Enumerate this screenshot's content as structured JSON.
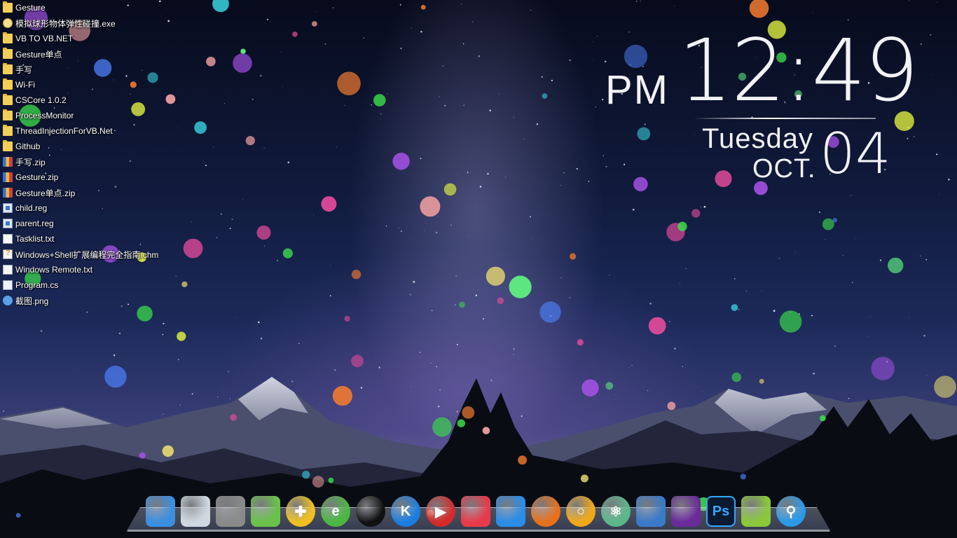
{
  "desktop_items": [
    {
      "label": "Gesture",
      "icon": "folder-icon"
    },
    {
      "label": "模拟球形物体弹性碰撞.exe",
      "icon": "exe-icon"
    },
    {
      "label": "VB TO VB.NET",
      "icon": "folder-icon"
    },
    {
      "label": "Gesture单点",
      "icon": "folder-icon"
    },
    {
      "label": "手写",
      "icon": "folder-icon"
    },
    {
      "label": "Wi-Fi",
      "icon": "folder-icon"
    },
    {
      "label": "CSCore 1.0.2",
      "icon": "folder-icon"
    },
    {
      "label": "ProcessMonitor",
      "icon": "folder-icon"
    },
    {
      "label": "ThreadInjectionForVB.Net",
      "icon": "folder-icon"
    },
    {
      "label": "Github",
      "icon": "folder-icon"
    },
    {
      "label": "手写.zip",
      "icon": "zip-icon"
    },
    {
      "label": "Gesture.zip",
      "icon": "zip-icon"
    },
    {
      "label": "Gesture单点.zip",
      "icon": "zip-icon"
    },
    {
      "label": "child.reg",
      "icon": "reg-icon"
    },
    {
      "label": "parent.reg",
      "icon": "reg-icon"
    },
    {
      "label": "Tasklist.txt",
      "icon": "txt-icon"
    },
    {
      "label": "Windows+Shell扩展编程完全指南.chm",
      "icon": "chm-icon"
    },
    {
      "label": "Windows Remote.txt",
      "icon": "txt-icon"
    },
    {
      "label": "Program.cs",
      "icon": "cs-icon"
    },
    {
      "label": "截图.png",
      "icon": "png-icon"
    }
  ],
  "clock": {
    "ampm": "PM",
    "time": "12:49",
    "weekday": "Tuesday",
    "month": "OCT.",
    "day": "04"
  },
  "dock": [
    {
      "name": "computer-icon",
      "glyph": "",
      "color": "#3b8fe0"
    },
    {
      "name": "recycle-bin-icon",
      "glyph": "",
      "color": "#cfd8e0"
    },
    {
      "name": "windows-tiles-icon",
      "glyph": "",
      "color": "#8a8a8a"
    },
    {
      "name": "android-folder-icon",
      "glyph": "",
      "color": "#6ac24a"
    },
    {
      "name": "360-security-icon",
      "glyph": "✚",
      "color": "#f0c020"
    },
    {
      "name": "ie-browser-icon",
      "glyph": "e",
      "color": "#4ab840"
    },
    {
      "name": "qq-penguin-icon",
      "glyph": "",
      "color": "#111111"
    },
    {
      "name": "kugou-music-icon",
      "glyph": "K",
      "color": "#1a7ee0"
    },
    {
      "name": "media-player-icon",
      "glyph": "▶",
      "color": "#d42a2a"
    },
    {
      "name": "tmall-cat-icon",
      "glyph": "",
      "color": "#e83a4a"
    },
    {
      "name": "feige-bird-icon",
      "glyph": "",
      "color": "#2a8de8"
    },
    {
      "name": "firefox-icon",
      "glyph": "",
      "color": "#e8701a"
    },
    {
      "name": "chrome-like-icon",
      "glyph": "○",
      "color": "#f0a818"
    },
    {
      "name": "atom-editor-icon",
      "glyph": "⚛",
      "color": "#5ab88a"
    },
    {
      "name": "vmware-icon",
      "glyph": "",
      "color": "#3a7ac8"
    },
    {
      "name": "visual-studio-icon",
      "glyph": "",
      "color": "#6a2a9a"
    },
    {
      "name": "photoshop-icon",
      "glyph": "Ps",
      "color": "#0a1a30"
    },
    {
      "name": "notepad-plus-icon",
      "glyph": "",
      "color": "#8ac83a"
    },
    {
      "name": "search-icon",
      "glyph": "⚲",
      "color": "#2a9ae8"
    }
  ]
}
